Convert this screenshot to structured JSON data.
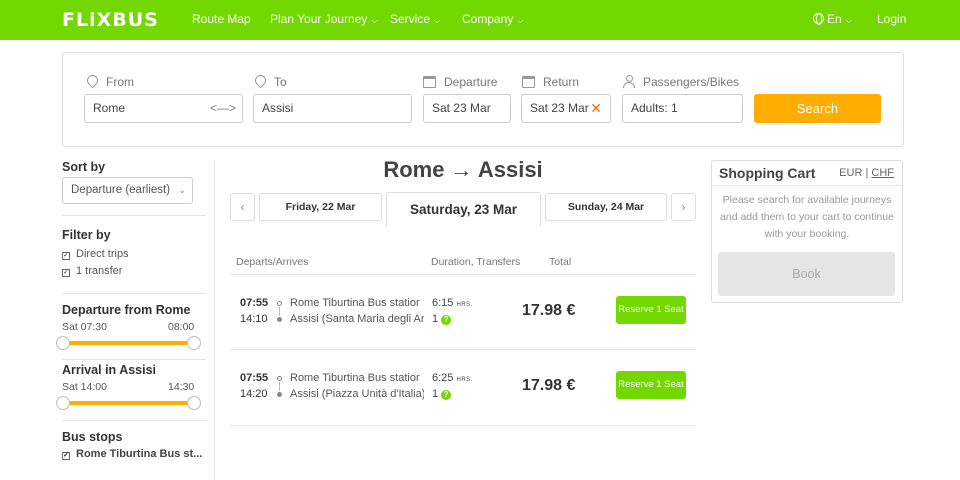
{
  "nav": {
    "logo": "FLiXBUS",
    "route_map": "Route Map",
    "plan_journey": "Plan Your Journey",
    "service": "Service",
    "company": "Company",
    "language": "En",
    "login": "Login"
  },
  "search": {
    "from_label": "From",
    "from_value": "Rome",
    "to_label": "To",
    "to_value": "Assisi",
    "departure_label": "Departure",
    "departure_value": "Sat 23 Mar",
    "return_label": "Return",
    "return_value": "Sat 23 Mar",
    "passengers_label": "Passengers/Bikes",
    "passengers_value": "Adults: 1",
    "search_button": "Search"
  },
  "sidebar": {
    "sort_by": "Sort by",
    "sort_value": "Departure (earliest)",
    "filter_by": "Filter by",
    "filter_direct": "Direct trips",
    "filter_one_transfer": "1 transfer",
    "departure_from": "Departure from Rome",
    "departure_min": "Sat 07:30",
    "departure_max": "08:00",
    "arrival_in": "Arrival in Assisi",
    "arrival_min": "Sat 14:00",
    "arrival_max": "14:30",
    "bus_stops": "Bus stops",
    "bus_stop_item": "Rome Tiburtina Bus st..."
  },
  "results": {
    "route_title": "Rome → Assisi",
    "prev_day": "Friday, 22 Mar",
    "current_day": "Saturday, 23 Mar",
    "next_day": "Sunday, 24 Mar",
    "col_departs": "Departs/Arrives",
    "col_duration": "Duration, Transfers",
    "col_total": "Total",
    "trips": [
      {
        "depart": "07:55",
        "arrive": "14:10",
        "from_stop": "Rome Tiburtina Bus station",
        "to_stop": "Assisi (Santa Maria degli An...",
        "duration": "6:15",
        "duration_unit": "HRS.",
        "transfers": "1",
        "price": "17.98 €",
        "reserve": "Reserve 1 Seat"
      },
      {
        "depart": "07:55",
        "arrive": "14:20",
        "from_stop": "Rome Tiburtina Bus station",
        "to_stop": "Assisi (Piazza Unità d'Italia)",
        "duration": "6:25",
        "duration_unit": "HRS.",
        "transfers": "1",
        "price": "17.98 €",
        "reserve": "Reserve 1 Seat"
      }
    ]
  },
  "cart": {
    "title": "Shopping Cart",
    "currency_eur": "EUR",
    "currency_sep": "|",
    "currency_chf": "CHF",
    "message": "Please search for available journeys and add them to your cart to continue with your booking.",
    "book": "Book"
  },
  "colors": {
    "brand_green": "#73d700",
    "accent_orange": "#ffad00"
  }
}
